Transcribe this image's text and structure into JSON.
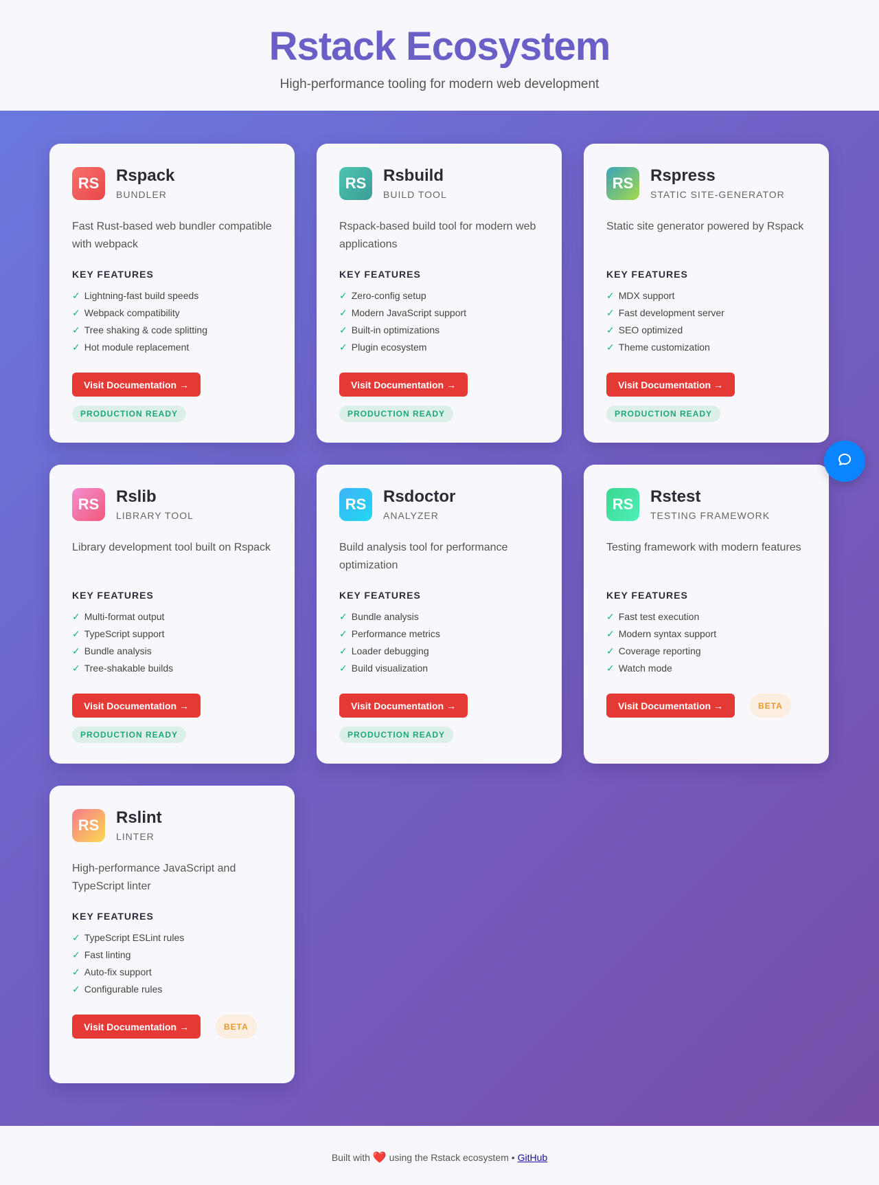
{
  "header": {
    "title": "Rstack Ecosystem",
    "subtitle": "High-performance tooling for modern web development"
  },
  "cards": [
    {
      "logo": "RS",
      "name": "Rspack",
      "category": "BUNDLER",
      "description": "Fast Rust-based web bundler compatible with webpack",
      "features_heading": "KEY FEATURES",
      "features": [
        "Lightning-fast build speeds",
        "Webpack compatibility",
        "Tree shaking & code splitting",
        "Hot module replacement"
      ],
      "button": "Visit Documentation →",
      "badge": "PRODUCTION READY",
      "badge_type": "ready",
      "colors": [
        "#f7706c",
        "#e8474b"
      ]
    },
    {
      "logo": "RS",
      "name": "Rsbuild",
      "category": "BUILD TOOL",
      "description": "Rspack-based build tool for modern web applications",
      "features_heading": "KEY FEATURES",
      "features": [
        "Zero-config setup",
        "Modern JavaScript support",
        "Built-in optimizations",
        "Plugin ecosystem"
      ],
      "button": "Visit Documentation →",
      "badge": "PRODUCTION READY",
      "badge_type": "ready",
      "colors": [
        "#4ec4b4",
        "#3a9e96"
      ]
    },
    {
      "logo": "RS",
      "name": "Rspress",
      "category": "STATIC SITE-GENERATOR",
      "description": "Static site generator powered by Rspack",
      "features_heading": "KEY FEATURES",
      "features": [
        "MDX support",
        "Fast development server",
        "SEO optimized",
        "Theme customization"
      ],
      "button": "Visit Documentation →",
      "badge": "PRODUCTION READY",
      "badge_type": "ready",
      "colors": [
        "#3aa3b8",
        "#a4d94c"
      ]
    },
    {
      "logo": "RS",
      "name": "Rslib",
      "category": "LIBRARY TOOL",
      "description": "Library development tool built on Rspack",
      "features_heading": "KEY FEATURES",
      "features": [
        "Multi-format output",
        "TypeScript support",
        "Bundle analysis",
        "Tree-shakable builds"
      ],
      "button": "Visit Documentation →",
      "badge": "PRODUCTION READY",
      "badge_type": "ready",
      "colors": [
        "#f48fd0",
        "#f0577a"
      ]
    },
    {
      "logo": "RS",
      "name": "Rsdoctor",
      "category": "ANALYZER",
      "description": "Build analysis tool for performance optimization",
      "features_heading": "KEY FEATURES",
      "features": [
        "Bundle analysis",
        "Performance metrics",
        "Loader debugging",
        "Build visualization"
      ],
      "button": "Visit Documentation →",
      "badge": "PRODUCTION READY",
      "badge_type": "ready",
      "colors": [
        "#3eb3f7",
        "#21d7f0"
      ]
    },
    {
      "logo": "RS",
      "name": "Rstest",
      "category": "TESTING FRAMEWORK",
      "description": "Testing framework with modern features",
      "features_heading": "KEY FEATURES",
      "features": [
        "Fast test execution",
        "Modern syntax support",
        "Coverage reporting",
        "Watch mode"
      ],
      "button": "Visit Documentation →",
      "badge": "BETA",
      "badge_type": "beta",
      "colors": [
        "#3bd690",
        "#4cf0b8"
      ]
    },
    {
      "logo": "RS",
      "name": "Rslint",
      "category": "LINTER",
      "description": "High-performance JavaScript and TypeScript linter",
      "features_heading": "KEY FEATURES",
      "features": [
        "TypeScript ESLint rules",
        "Fast linting",
        "Auto-fix support",
        "Configurable rules"
      ],
      "button": "Visit Documentation →",
      "badge": "BETA",
      "badge_type": "beta",
      "colors": [
        "#f57c8e",
        "#fcd84e"
      ]
    }
  ],
  "chat": {
    "icon": "chat-bubble-icon",
    "color": "#0a84ff"
  },
  "footer": {
    "prefix": "Built with",
    "heart": "❤️",
    "suffix": "using the Rstack ecosystem •",
    "link": "GitHub"
  }
}
